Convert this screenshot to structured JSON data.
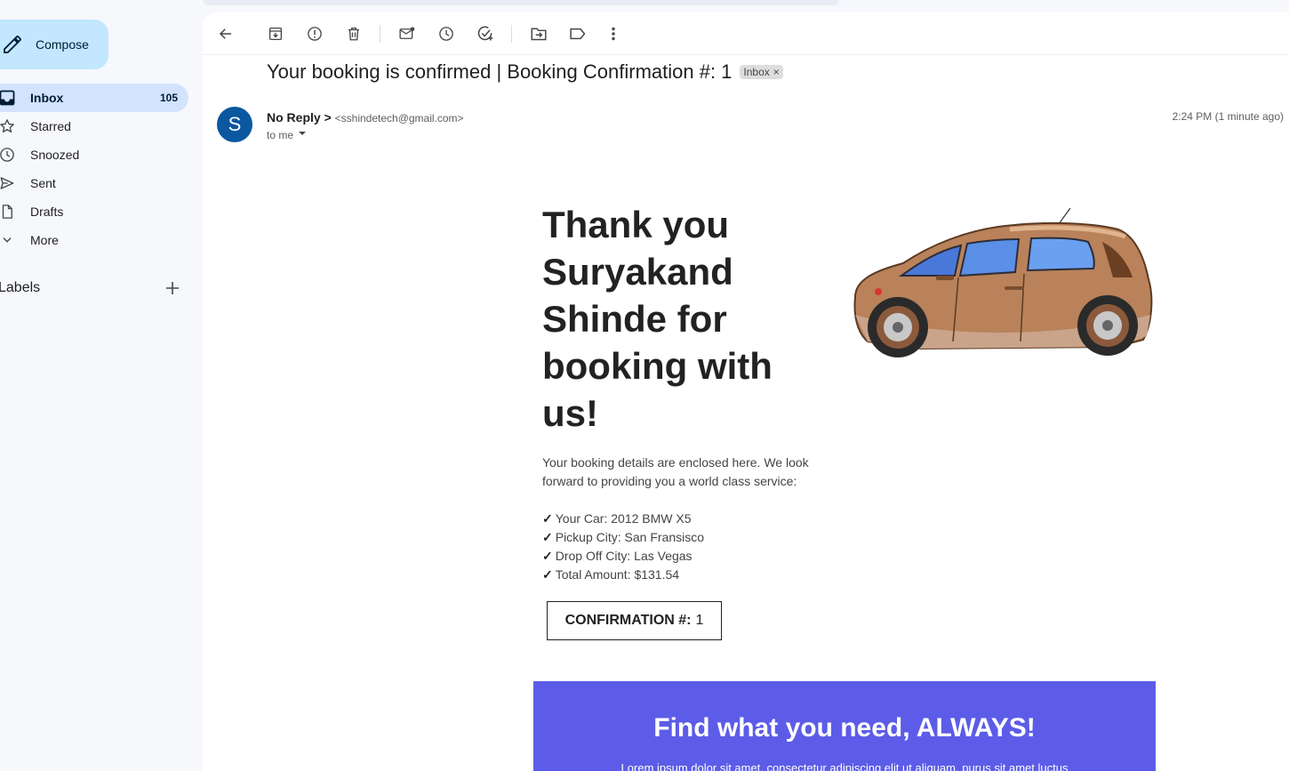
{
  "sidebar": {
    "compose_label": "Compose",
    "items": [
      {
        "label": "Inbox",
        "count": "105",
        "icon": "inbox-icon"
      },
      {
        "label": "Starred",
        "icon": "star-icon"
      },
      {
        "label": "Snoozed",
        "icon": "clock-icon"
      },
      {
        "label": "Sent",
        "icon": "send-icon"
      },
      {
        "label": "Drafts",
        "icon": "draft-icon"
      },
      {
        "label": "More",
        "icon": "chevron-down-icon"
      }
    ],
    "labels_title": "Labels"
  },
  "toolbar": {
    "icons": [
      "back-icon",
      "archive-icon",
      "report-spam-icon",
      "delete-icon",
      "mark-unread-icon",
      "snooze-icon",
      "add-task-icon",
      "move-to-icon",
      "label-icon",
      "more-icon"
    ]
  },
  "email": {
    "subject": "Your booking is confirmed | Booking Confirmation #: 1",
    "chip_label": "Inbox",
    "chip_close": "×",
    "avatar_letter": "S",
    "sender_name": "No Reply >",
    "sender_email": "<sshindetech@gmail.com>",
    "to_label": "to me",
    "timestamp": "2:24 PM (1 minute ago)"
  },
  "body": {
    "headline": "Thank you Suryakand Shinde for booking with us!",
    "intro": "Your booking details are enclosed here. We look forward to providing you a world class service:",
    "check_mark": "✓",
    "details": [
      "Your Car: 2012 BMW X5",
      "Pickup City: San Fransisco",
      "Drop Off City: Las Vegas",
      "Total Amount: $131.54"
    ],
    "confirmation_label": "CONFIRMATION #:",
    "confirmation_number": "1",
    "promo_title": "Find what you need, ALWAYS!",
    "promo_text": "Lorem ipsum dolor sit amet, consectetur adipiscing elit ut aliquam, purus sit amet luctus"
  },
  "colors": {
    "compose_bg": "#c2e7ff",
    "active_nav_bg": "#d3e3fd",
    "avatar_bg": "#0b57a0",
    "promo_bg": "#5c5ce8",
    "car_body": "#b9825a"
  }
}
